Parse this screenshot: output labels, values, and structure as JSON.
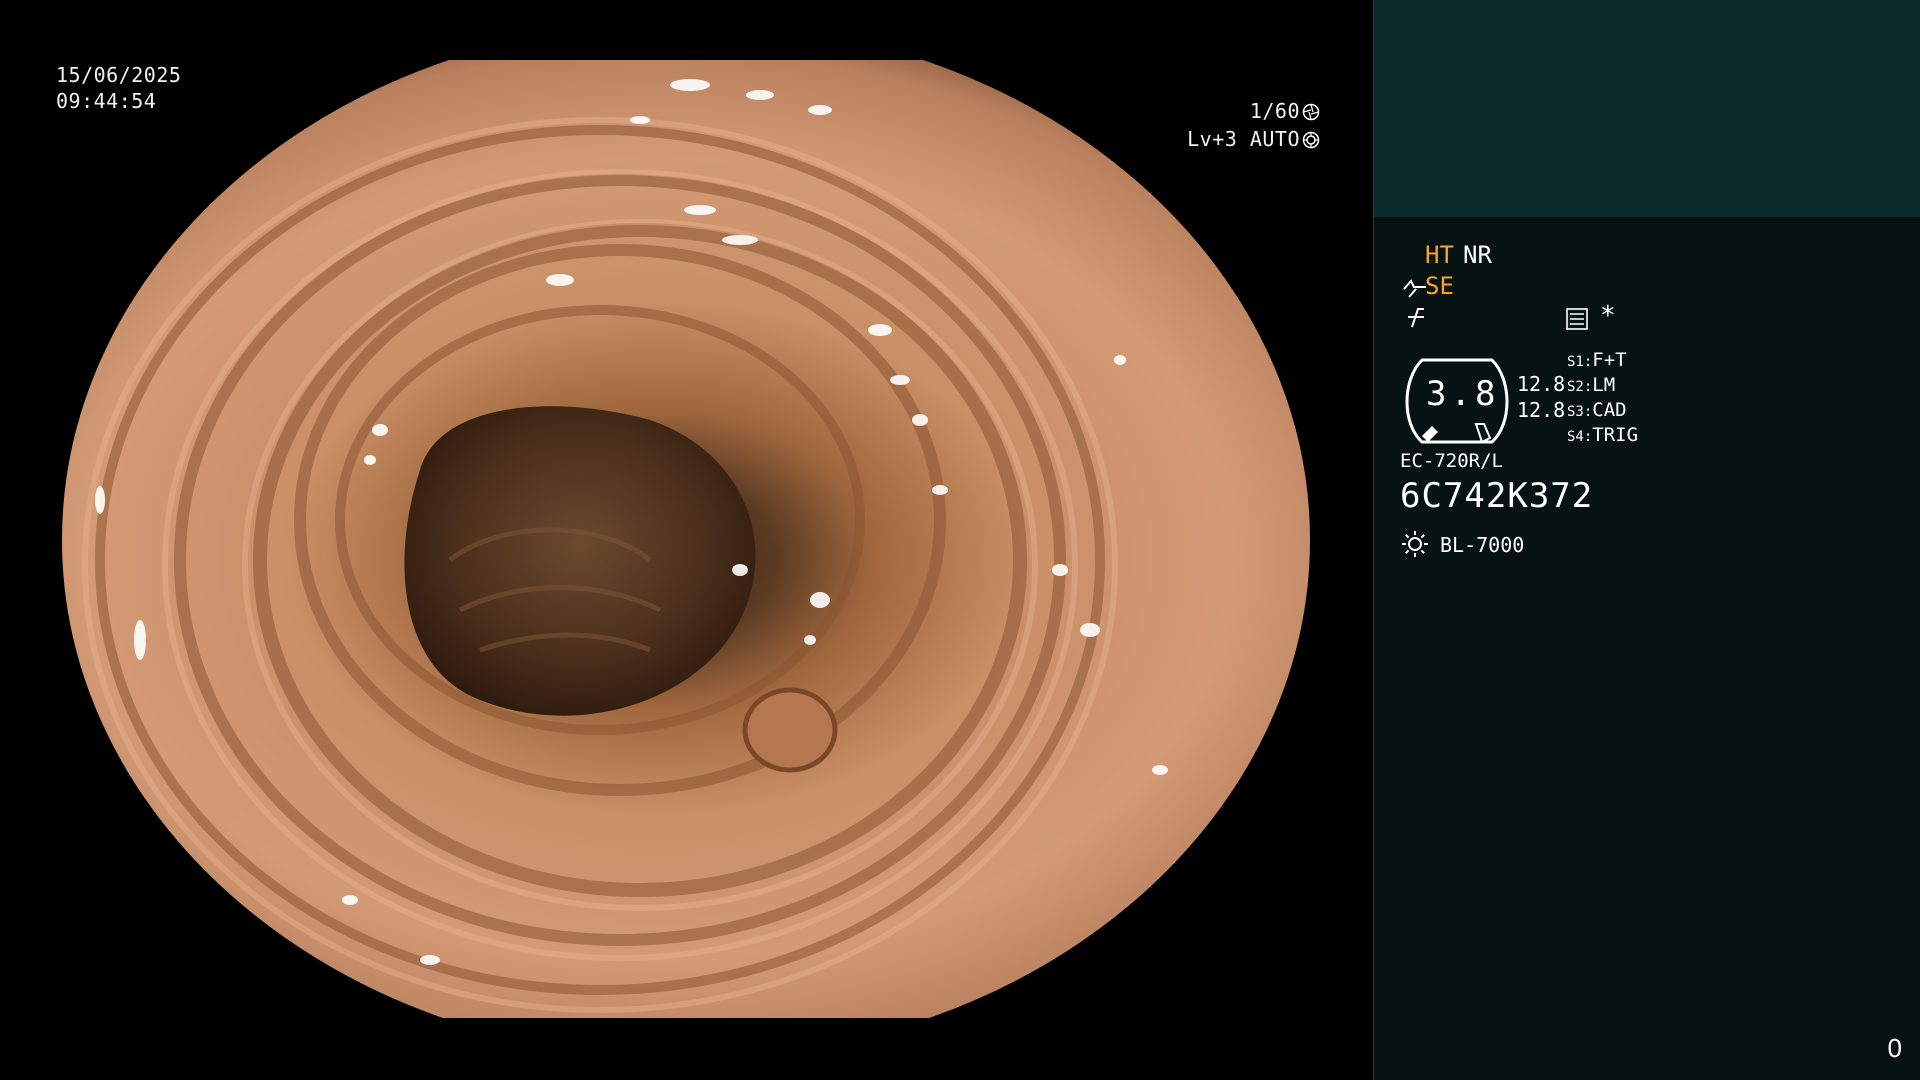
{
  "video": {
    "date": "15/06/2025",
    "time": "09:44:54",
    "shutter": "1/60",
    "shutter_icon": "aperture-icon",
    "level": "Lv+3 AUTO",
    "level_icon": "iris-icon"
  },
  "panel": {
    "ht": "HT",
    "nr": "NR",
    "se": "SE",
    "ht_color": "#f5a623",
    "se_color": "#f5a623",
    "asterisk": "*",
    "gauge_value": "3.8",
    "readout_1": "12.8",
    "readout_2": "12.8",
    "switches": [
      {
        "key": "S1:",
        "value": "F+T"
      },
      {
        "key": "S2:",
        "value": "LM"
      },
      {
        "key": "S3:",
        "value": "CAD"
      },
      {
        "key": "S4:",
        "value": "TRIG"
      }
    ],
    "scope_model": "EC-720R/L",
    "serial": "6C742K372",
    "light_source": "BL-7000"
  },
  "counter": "0"
}
